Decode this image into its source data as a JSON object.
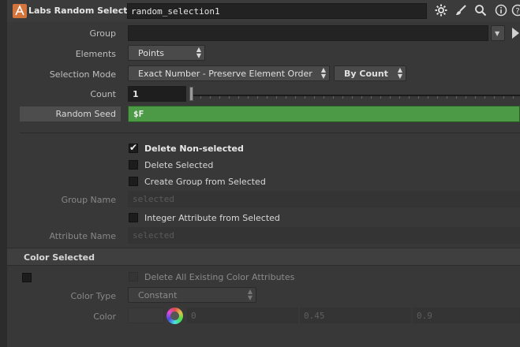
{
  "header": {
    "node_type": "Labs Random Selection",
    "node_name": "random_selection1",
    "icons": [
      "gear-icon",
      "brush-icon",
      "search-icon",
      "info-icon",
      "help-icon"
    ]
  },
  "params": {
    "group": {
      "label": "Group",
      "value": ""
    },
    "elements": {
      "label": "Elements",
      "value": "Points"
    },
    "selection_mode": {
      "label": "Selection Mode",
      "value": "Exact Number - Preserve Element Order",
      "mode2": "By Count"
    },
    "count": {
      "label": "Count",
      "value": "1"
    },
    "random_seed": {
      "label": "Random Seed",
      "value": "$F"
    },
    "delete_nonselected": {
      "label": "Delete Non-selected",
      "checked": true
    },
    "delete_selected": {
      "label": "Delete Selected",
      "checked": false
    },
    "create_group": {
      "label": "Create Group from Selected",
      "checked": false
    },
    "group_name": {
      "label": "Group Name",
      "placeholder": "selected"
    },
    "int_attrib": {
      "label": "Integer Attribute from Selected",
      "checked": false
    },
    "attribute_name": {
      "label": "Attribute Name",
      "placeholder": "selected"
    }
  },
  "color_section": {
    "title": "Color Selected",
    "delete_existing": {
      "label": "Delete All Existing Color Attributes",
      "checked": false
    },
    "color_type": {
      "label": "Color Type",
      "value": "Constant"
    },
    "color": {
      "label": "Color",
      "r": "0",
      "g": "0.45",
      "b": "0.9"
    }
  }
}
